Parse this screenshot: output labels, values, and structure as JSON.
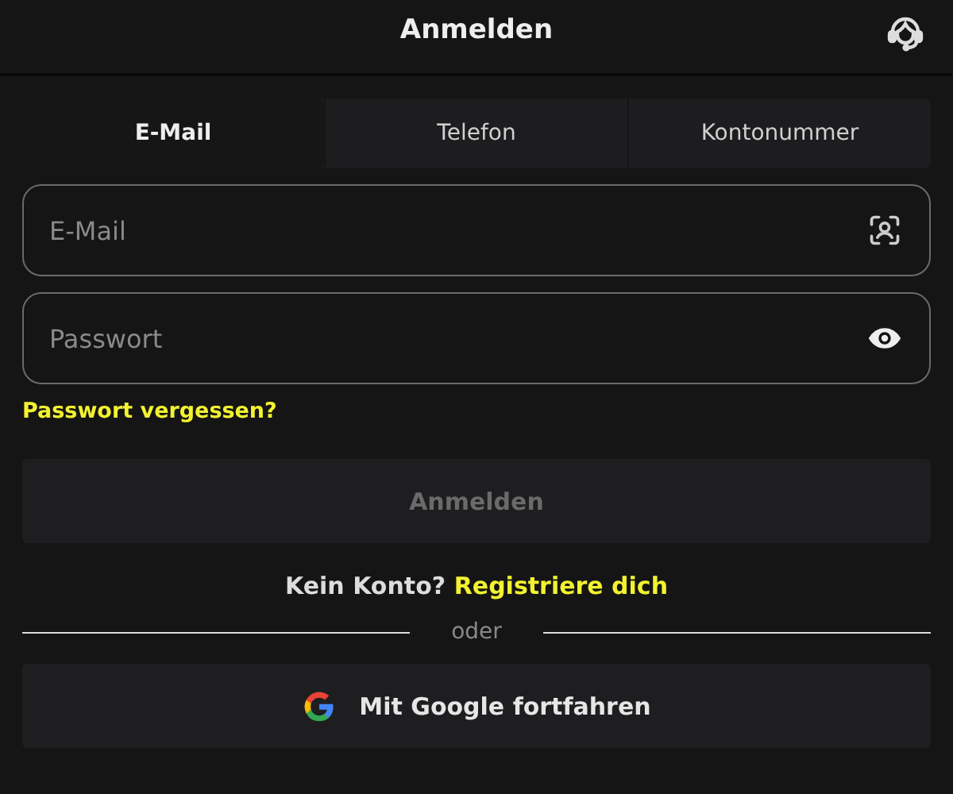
{
  "header": {
    "title": "Anmelden"
  },
  "tabs": [
    {
      "label": "E-Mail",
      "selected": true
    },
    {
      "label": "Telefon",
      "selected": false
    },
    {
      "label": "Kontonummer",
      "selected": false
    }
  ],
  "fields": [
    {
      "kind": "email",
      "placeholder": "E-Mail"
    },
    {
      "kind": "password",
      "placeholder": "Passwort"
    }
  ],
  "forgot_link": "Passwort vergessen?",
  "login_button": {
    "label": "Anmelden",
    "disabled": true
  },
  "signup": {
    "text": "Kein Konto?",
    "link": "Registriere dich"
  },
  "divider": "oder",
  "google_button": "Mit Google fortfahren"
}
